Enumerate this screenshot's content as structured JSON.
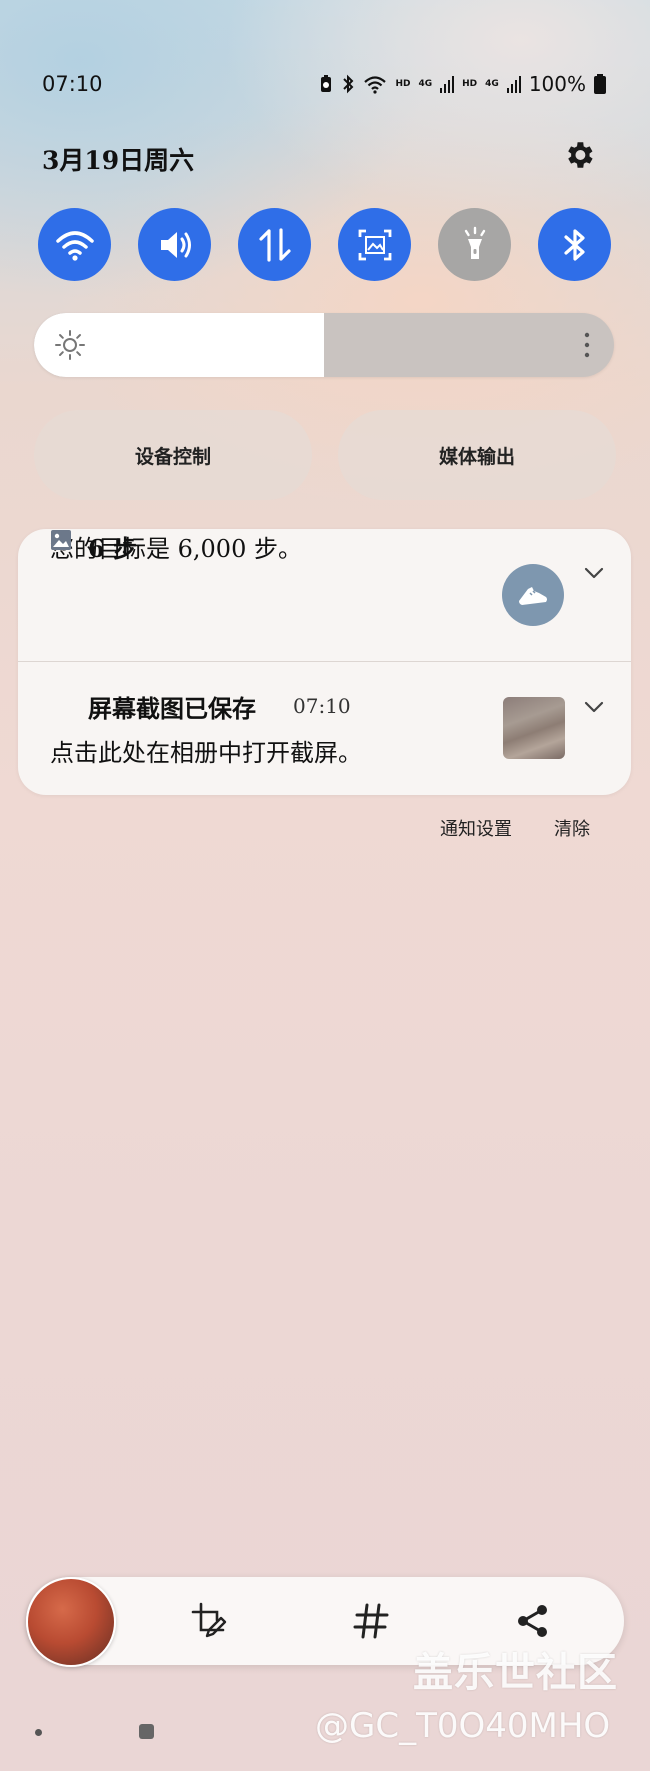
{
  "status_bar": {
    "time": "07:10",
    "hd_1": "HD",
    "net_1": "4G",
    "hd_2": "HD",
    "net_2": "4G",
    "battery": "100%",
    "icons": [
      "battery-saver-icon",
      "bluetooth-icon",
      "wifi-icon",
      "signal-icon",
      "battery-icon"
    ]
  },
  "header": {
    "date": "3月19日周六",
    "settings_icon": "gear-icon"
  },
  "quick_settings": [
    {
      "icon": "wifi-icon",
      "active": true
    },
    {
      "icon": "sound-icon",
      "active": true
    },
    {
      "icon": "mobile-data-icon",
      "active": true
    },
    {
      "icon": "screenshot-icon",
      "active": true
    },
    {
      "icon": "flashlight-icon",
      "active": false
    },
    {
      "icon": "bluetooth-icon",
      "active": true
    }
  ],
  "brightness": {
    "level": 0.5,
    "icon": "sun-icon"
  },
  "controls": {
    "device_control": "设备控制",
    "media_output": "媒体输出"
  },
  "notifications": [
    {
      "icon": "step-counter-icon",
      "title": "6 步",
      "body": "您的目标是 6,000 步。",
      "action_icon": "shoe-icon"
    },
    {
      "icon": "image-icon",
      "title": "屏幕截图已保存",
      "time": "07:10",
      "body": "点击此处在相册中打开截屏。"
    }
  ],
  "actions": {
    "notification_settings": "通知设置",
    "clear": "清除"
  },
  "toolbar": {
    "icons": [
      "edit-crop-icon",
      "hashtag-icon",
      "share-icon"
    ]
  },
  "watermark": {
    "line1": "盖乐世社区",
    "line2": "@GC_T0O40MHO"
  },
  "colors": {
    "accent": "#2f6ee8",
    "off": "#a7a6a5",
    "shoe_badge": "#7e97af"
  }
}
